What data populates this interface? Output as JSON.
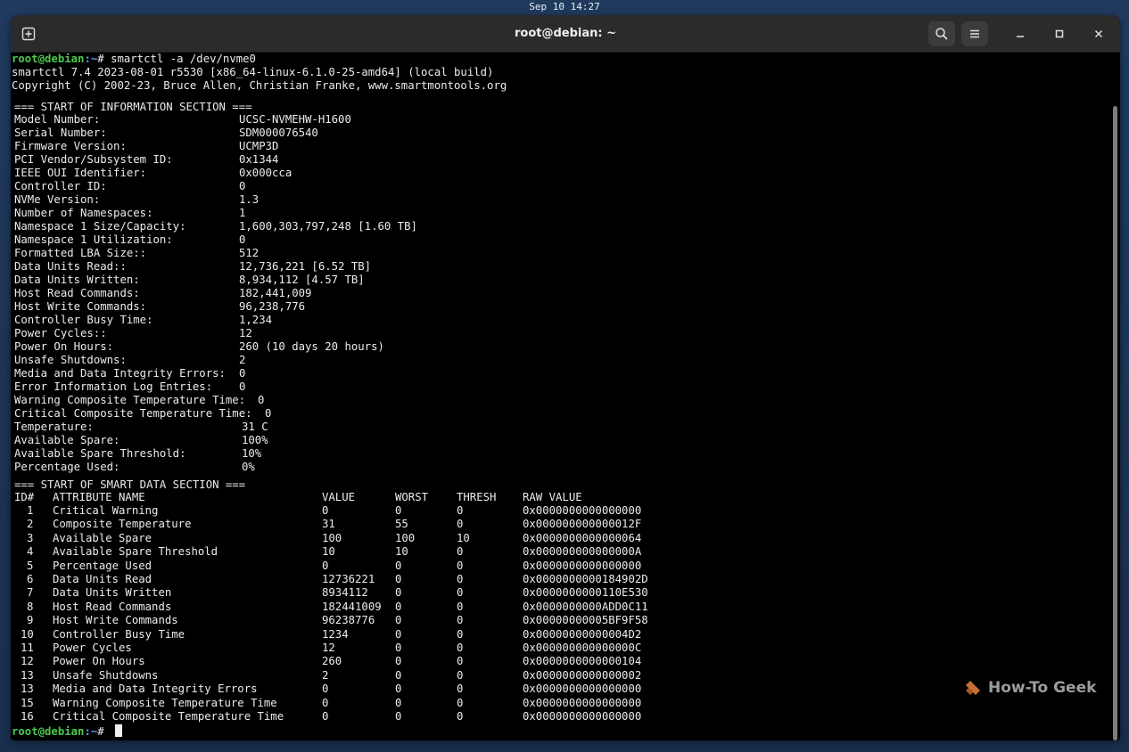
{
  "system": {
    "clock": "Sep 10 14:27"
  },
  "window": {
    "title": "root@debian: ~"
  },
  "prompt": {
    "user_host": "root@debian",
    "path_suffix": ":~",
    "symbol": "# "
  },
  "command": "smartctl -a /dev/nvme0",
  "output": {
    "version": "smartctl 7.4 2023-08-01 r5530 [x86_64-linux-6.1.0-25-amd64] (local build)",
    "copyright": "Copyright (C) 2002-23, Bruce Allen, Christian Franke, www.smartmontools.org",
    "info_header": "=== START OF INFORMATION SECTION ===",
    "info_rows": [
      {
        "label": "Model Number:",
        "value": "UCSC-NVMEHW-H1600"
      },
      {
        "label": "Serial Number:",
        "value": "SDM000076540"
      },
      {
        "label": "Firmware Version:",
        "value": "UCMP3D"
      },
      {
        "label": "PCI Vendor/Subsystem ID:",
        "value": "0x1344"
      },
      {
        "label": "IEEE OUI Identifier:",
        "value": "0x000cca"
      },
      {
        "label": "Controller ID:",
        "value": "0"
      },
      {
        "label": "NVMe Version:",
        "value": "1.3"
      },
      {
        "label": "Number of Namespaces:",
        "value": "1"
      },
      {
        "label": "Namespace 1 Size/Capacity:",
        "value": "1,600,303,797,248 [1.60 TB]"
      },
      {
        "label": "Namespace 1 Utilization:",
        "value": "0"
      },
      {
        "label": "Formatted LBA Size::",
        "value": "512"
      },
      {
        "label": "Data Units Read::",
        "value": "12,736,221 [6.52 TB]"
      },
      {
        "label": "Data Units Written:",
        "value": "8,934,112 [4.57 TB]"
      },
      {
        "label": "Host Read Commands:",
        "value": "182,441,009"
      },
      {
        "label": "Host Write Commands:",
        "value": "96,238,776"
      },
      {
        "label": "Controller Busy Time:",
        "value": "1,234"
      },
      {
        "label": "Power Cycles::",
        "value": "12"
      },
      {
        "label": "Power On Hours:",
        "value": "260 (10 days 20 hours)"
      },
      {
        "label": "Unsafe Shutdowns:",
        "value": "2"
      },
      {
        "label": "Media and Data Integrity Errors:",
        "value": "0"
      },
      {
        "label": "Error Information Log Entries:",
        "value": "0"
      },
      {
        "label": "Warning Composite Temperature Time:",
        "value": "0"
      },
      {
        "label": "Critical Composite Temperature Time:",
        "value": "0"
      },
      {
        "label": "Temperature:",
        "value": "31 C"
      },
      {
        "label": "Available Spare:",
        "value": "100%"
      },
      {
        "label": "Available Spare Threshold:",
        "value": "10%"
      },
      {
        "label": "Percentage Used:",
        "value": "0%"
      }
    ],
    "smart_header": "=== START OF SMART DATA SECTION ===",
    "smart_columns": [
      "ID#",
      "ATTRIBUTE NAME",
      "VALUE",
      "WORST",
      "THRESH",
      "RAW VALUE"
    ],
    "smart_rows": [
      [
        "1",
        "Critical Warning",
        "0",
        "0",
        "0",
        "0x0000000000000000"
      ],
      [
        "2",
        "Composite Temperature",
        "31",
        "55",
        "0",
        "0x000000000000012F"
      ],
      [
        "3",
        "Available Spare",
        "100",
        "100",
        "10",
        "0x0000000000000064"
      ],
      [
        "4",
        "Available Spare Threshold",
        "10",
        "10",
        "0",
        "0x000000000000000A"
      ],
      [
        "5",
        "Percentage Used",
        "0",
        "0",
        "0",
        "0x0000000000000000"
      ],
      [
        "6",
        "Data Units Read",
        "12736221",
        "0",
        "0",
        "0x0000000000184902D"
      ],
      [
        "7",
        "Data Units Written",
        "8934112",
        "0",
        "0",
        "0x0000000000110E530"
      ],
      [
        "8",
        "Host Read Commands",
        "182441009",
        "0",
        "0",
        "0x0000000000ADD0C11"
      ],
      [
        "9",
        "Host Write Commands",
        "96238776",
        "0",
        "0",
        "0x00000000005BF9F58"
      ],
      [
        "10",
        "Controller Busy Time",
        "1234",
        "0",
        "0",
        "0x00000000000004D2"
      ],
      [
        "11",
        "Power Cycles",
        "12",
        "0",
        "0",
        "0x000000000000000C"
      ],
      [
        "12",
        "Power On Hours",
        "260",
        "0",
        "0",
        "0x0000000000000104"
      ],
      [
        "13",
        "Unsafe Shutdowns",
        "2",
        "0",
        "0",
        "0x0000000000000002"
      ],
      [
        "13",
        "Media and Data Integrity Errors",
        "0",
        "0",
        "0",
        "0x0000000000000000"
      ],
      [
        "15",
        "Warning Composite Temperature Time",
        "0",
        "0",
        "0",
        "0x0000000000000000"
      ],
      [
        "16",
        "Critical Composite Temperature Time",
        "0",
        "0",
        "0",
        "0x0000000000000000"
      ]
    ]
  },
  "watermark": {
    "text": "How-To Geek"
  },
  "icons": {
    "new_tab": "new-tab-icon",
    "search": "search-icon",
    "menu": "hamburger-menu-icon",
    "minimize": "minimize-icon",
    "maximize": "maximize-icon",
    "close": "close-icon"
  },
  "colors": {
    "prompt_user": "#4ec94e",
    "prompt_path": "#5c9cf5",
    "terminal_bg": "#000000",
    "terminal_fg": "#ececec",
    "titlebar_bg": "#2b2b2b"
  }
}
